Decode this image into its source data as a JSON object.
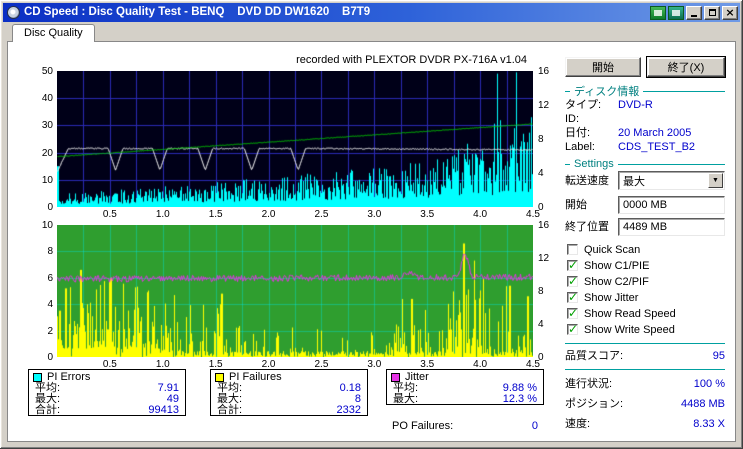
{
  "window": {
    "title": "CD Speed : Disc Quality Test - BENQ    DVD DD DW1620    B7T9"
  },
  "tabs": {
    "disc_quality": "Disc Quality"
  },
  "chart_header": {
    "recorded_with": "recorded with PLEXTOR DVDR   PX-716A   v1.04"
  },
  "chart_data": [
    {
      "name": "pi_errors_speed_chart",
      "type": "area",
      "x_range": [
        0,
        4.5
      ],
      "x_ticks": [
        "0.5",
        "1.0",
        "1.5",
        "2.0",
        "2.5",
        "3.0",
        "3.5",
        "4.0",
        "4.5"
      ],
      "left_ticks": [
        "50",
        "40",
        "30",
        "20",
        "10",
        "0"
      ],
      "right_ticks": [
        "16",
        "12",
        "8",
        "4",
        "0"
      ],
      "left_max": 50,
      "grid_x_step": 0.25,
      "grid_y_step": 10,
      "bg": "#000018",
      "grid_color": "#2a2ab4",
      "series": [
        {
          "name": "PI Errors",
          "color": "#00ffff",
          "style": "bars",
          "avg": 7.91,
          "max": 49,
          "total": 99413,
          "base_points": [
            [
              0,
              3.2
            ],
            [
              1.0,
              5.0
            ],
            [
              2.0,
              7.0
            ],
            [
              3.0,
              9.5
            ],
            [
              3.6,
              11.5
            ],
            [
              4.0,
              13.5
            ],
            [
              4.5,
              16.0
            ]
          ],
          "spike_start": 3.7,
          "spike_max": 50
        },
        {
          "name": "Read Speed",
          "color": "#f8f8f8",
          "style": "line",
          "points": [
            [
              0,
              13.0
            ],
            [
              0.1,
              21.5
            ],
            [
              2.5,
              21.5
            ],
            [
              4.5,
              21.0
            ]
          ],
          "dip_centers": [
            0.55,
            0.97,
            1.4,
            1.84,
            2.28
          ],
          "dip_floor": 13.5,
          "dip_halfwidth": 0.07,
          "noise": 0.4
        },
        {
          "name": "Write Speed",
          "color": "#00cc00",
          "style": "line",
          "points": [
            [
              0,
              18.5
            ],
            [
              4.5,
              30.5
            ]
          ],
          "noise": 0.2
        }
      ]
    },
    {
      "name": "pi_failures_jitter_chart",
      "type": "spikes",
      "x_range": [
        0,
        4.5
      ],
      "x_ticks": [
        "0.5",
        "1.0",
        "1.5",
        "2.0",
        "2.5",
        "3.0",
        "3.5",
        "4.0",
        "4.5"
      ],
      "left_ticks": [
        "10",
        "8",
        "6",
        "4",
        "2",
        "0"
      ],
      "right_ticks": [
        "16",
        "12",
        "8",
        "4",
        "0"
      ],
      "left_max": 10,
      "grid_x_step": 0.25,
      "grid_y_step": 2,
      "bg": "#2f9e2f",
      "grid_color": "rgba(0,230,230,0.40)",
      "series": [
        {
          "name": "PI Failures",
          "color": "#ffff00",
          "style": "bars",
          "avg": 0.18,
          "max": 8,
          "total": 2332,
          "density_points": [
            [
              0,
              0.95
            ],
            [
              1.05,
              0.9
            ],
            [
              1.15,
              0.45
            ],
            [
              1.7,
              0.5
            ],
            [
              1.85,
              0.22
            ],
            [
              3.1,
              0.2
            ],
            [
              3.25,
              0.55
            ],
            [
              3.55,
              0.5
            ],
            [
              3.65,
              0.25
            ],
            [
              3.78,
              0.9
            ],
            [
              3.95,
              0.85
            ],
            [
              4.05,
              0.5
            ],
            [
              4.5,
              0.5
            ]
          ],
          "height_points": [
            [
              0,
              6.5
            ],
            [
              0.6,
              6.0
            ],
            [
              1.05,
              4.5
            ],
            [
              1.6,
              4.5
            ],
            [
              1.9,
              2.2
            ],
            [
              3.1,
              2.0
            ],
            [
              3.3,
              4.5
            ],
            [
              3.6,
              2.5
            ],
            [
              3.85,
              8.8
            ],
            [
              3.95,
              7.5
            ],
            [
              4.1,
              5.5
            ],
            [
              4.5,
              5.0
            ]
          ],
          "forced_spikes": [
            [
              3.85,
              8.6
            ],
            [
              0.22,
              6.6
            ],
            [
              0.5,
              6.0
            ],
            [
              0.08,
              5.2
            ],
            [
              1.55,
              4.8
            ],
            [
              3.35,
              4.4
            ],
            [
              4.28,
              5.4
            ],
            [
              4.45,
              4.6
            ]
          ]
        },
        {
          "name": "Jitter",
          "color": "#e632e6",
          "style": "line",
          "avg_pct": "9.88 %",
          "max_pct": "12.3 %",
          "points": [
            [
              0,
              5.9
            ],
            [
              4.5,
              6.05
            ]
          ],
          "noise": 0.5,
          "bumps": [
            {
              "center": 3.86,
              "width": 0.045,
              "amp": 1.75
            },
            {
              "center": 3.33,
              "width": 0.05,
              "amp": 0.4
            }
          ]
        }
      ]
    }
  ],
  "stats": {
    "pi_errors": {
      "label": "PI Errors",
      "swatch": "#00ffff",
      "rows": [
        {
          "label": "平均:",
          "value": "7.91"
        },
        {
          "label": "最大:",
          "value": "49"
        },
        {
          "label": "合計:",
          "value": "99413"
        }
      ]
    },
    "pi_failures": {
      "label": "PI Failures",
      "swatch": "#ffff00",
      "rows": [
        {
          "label": "平均:",
          "value": "0.18"
        },
        {
          "label": "最大:",
          "value": "8"
        },
        {
          "label": "合計:",
          "value": "2332"
        }
      ]
    },
    "jitter": {
      "label": "Jitter",
      "swatch": "#e632e6",
      "rows": [
        {
          "label": "平均:",
          "value": "9.88 %"
        },
        {
          "label": "最大:",
          "value": "12.3 %"
        }
      ]
    },
    "po_failures": {
      "label": "PO Failures:",
      "value": "0"
    }
  },
  "panel": {
    "start_button": "開始",
    "exit_button": "終了(X)",
    "disc_info": {
      "header": "ディスク情報",
      "rows": [
        {
          "label": "タイプ:",
          "value": "DVD-R"
        },
        {
          "label": "ID:",
          "value": ""
        },
        {
          "label": "日付:",
          "value": "20 March 2005"
        },
        {
          "label": "Label:",
          "value": "CDS_TEST_B2"
        }
      ]
    },
    "settings": {
      "header": "Settings",
      "speed_label": "転送速度",
      "speed_value": "最大",
      "start_label": "開始",
      "start_value": "0000 MB",
      "end_label": "終了位置",
      "end_value": "4489 MB",
      "checkboxes": [
        {
          "label": "Quick Scan",
          "checked": false
        },
        {
          "label": "Show C1/PIE",
          "checked": true
        },
        {
          "label": "Show C2/PIF",
          "checked": true
        },
        {
          "label": "Show Jitter",
          "checked": true
        },
        {
          "label": "Show Read Speed",
          "checked": true
        },
        {
          "label": "Show Write Speed",
          "checked": true
        }
      ]
    },
    "score": {
      "label": "品質スコア:",
      "value": "95"
    },
    "status": [
      {
        "label": "進行状況:",
        "value": "100 %"
      },
      {
        "label": "ポジション:",
        "value": "4488 MB"
      },
      {
        "label": "速度:",
        "value": "8.33 X"
      }
    ]
  }
}
